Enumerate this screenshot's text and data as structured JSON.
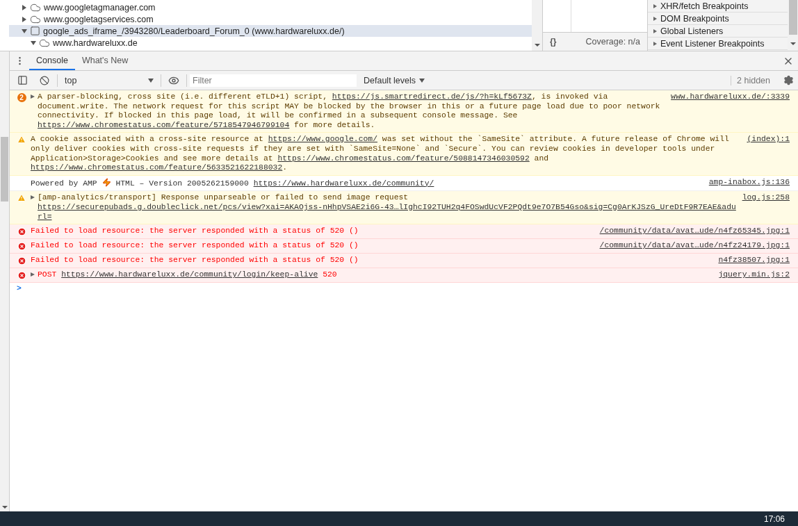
{
  "elements_tree": [
    {
      "label": "www.googletagmanager.com",
      "kind": "domain",
      "expanded": false,
      "selected": false
    },
    {
      "label": "www.googletagservices.com",
      "kind": "domain",
      "expanded": false,
      "selected": false
    },
    {
      "label": "google_ads_iframe_/3943280/Leaderboard_Forum_0 (www.hardwareluxx.de/)",
      "kind": "frame",
      "expanded": true,
      "selected": true,
      "children": [
        {
          "label": "www.hardwareluxx.de",
          "kind": "domain",
          "expanded": true,
          "selected": false
        }
      ]
    }
  ],
  "coverage": {
    "format_label": "{}",
    "text": "Coverage: n/a"
  },
  "breakpoint_sections": [
    {
      "label": "XHR/fetch Breakpoints",
      "expanded": false
    },
    {
      "label": "DOM Breakpoints",
      "expanded": false
    },
    {
      "label": "Global Listeners",
      "expanded": false
    },
    {
      "label": "Event Listener Breakpoints",
      "expanded": false
    }
  ],
  "drawer_tabs": [
    {
      "label": "Console",
      "selected": true
    },
    {
      "label": "What's New",
      "selected": false
    }
  ],
  "console_toolbar": {
    "context": "top",
    "filter_placeholder": "Filter",
    "levels": "Default levels",
    "hidden": "2 hidden"
  },
  "messages": [
    {
      "kind": "warning",
      "count": "2",
      "expanded": false,
      "parts": [
        {
          "kind": "text",
          "text": "A parser-blocking, cross site (i.e. different eTLD+1) script, "
        },
        {
          "kind": "link",
          "text": "https://js.smartredirect.de/js/?h=kLf5673Z"
        },
        {
          "kind": "text",
          "text": ", is invoked via document.write. The network request for this script MAY be blocked by the browser in this or a future page load due to poor network connectivity. If blocked in this page load, it will be confirmed in a subsequent console message. See "
        },
        {
          "kind": "link",
          "text": "https://www.chromestatus.com/feature/5718547946799104"
        },
        {
          "kind": "text",
          "text": " for more details."
        }
      ],
      "source": "www.hardwareluxx.de/:3339"
    },
    {
      "kind": "warning",
      "parts": [
        {
          "kind": "text",
          "text": "A cookie associated with a cross-site resource at "
        },
        {
          "kind": "link",
          "text": "https://www.google.com/"
        },
        {
          "kind": "text",
          "text": " was set without the `SameSite` attribute. A future release of Chrome will only deliver cookies with cross-site requests if they are set with `SameSite=None` and `Secure`. You can review cookies in developer tools under Application>Storage>Cookies and see more details at "
        },
        {
          "kind": "link",
          "text": "https://www.chromestatus.com/feature/5088147346030592"
        },
        {
          "kind": "text",
          "text": " and "
        },
        {
          "kind": "link",
          "text": "https://www.chromestatus.com/feature/5633521622188032"
        },
        {
          "kind": "text",
          "text": "."
        }
      ],
      "source": "(index):1"
    },
    {
      "kind": "info",
      "parts": [
        {
          "kind": "text",
          "text": "Powered by AMP "
        },
        {
          "kind": "icon"
        },
        {
          "kind": "text",
          "text": " HTML – Version 2005262159000 "
        },
        {
          "kind": "link",
          "text": "https://www.hardwareluxx.de/community/"
        }
      ],
      "source": "amp-inabox.js:136"
    },
    {
      "kind": "warning",
      "expanded": false,
      "parts": [
        {
          "kind": "text",
          "text": "[amp-analytics/transport] Response unparseable or failed to send image request "
        },
        {
          "kind": "link",
          "text": "https://securepubads.g.doubleclick.net/pcs/view?xai=AKAOjss-nHhpVSAE2i6G-43…lIghcI92TUH2q4FOSwdUcVF2PQdt9e7O7B54Gso&sig=Cg0ArKJSzG_UreDtF9R7EAE&adurl="
        }
      ],
      "source": "log.js:258"
    },
    {
      "kind": "error",
      "parts": [
        {
          "kind": "text",
          "text": "Failed to load resource: the server responded with a status of 520 ()"
        }
      ],
      "source": "/community/data/avat…ude/n4fz65345.jpg:1"
    },
    {
      "kind": "error",
      "parts": [
        {
          "kind": "text",
          "text": "Failed to load resource: the server responded with a status of 520 ()"
        }
      ],
      "source": "/community/data/avat…ude/n4fz24179.jpg:1"
    },
    {
      "kind": "error",
      "parts": [
        {
          "kind": "text",
          "text": "Failed to load resource: the server responded with a status of 520 ()"
        }
      ],
      "source": "n4fz38507.jpg:1"
    },
    {
      "kind": "error",
      "expanded": false,
      "parts": [
        {
          "kind": "text",
          "text": "POST "
        },
        {
          "kind": "link",
          "text": "https://www.hardwareluxx.de/community/login/keep-alive"
        },
        {
          "kind": "text",
          "text": " 520"
        }
      ],
      "source": "jquery.min.js:2"
    }
  ],
  "prompt": ">",
  "taskbar": {
    "clock": "17:06"
  }
}
